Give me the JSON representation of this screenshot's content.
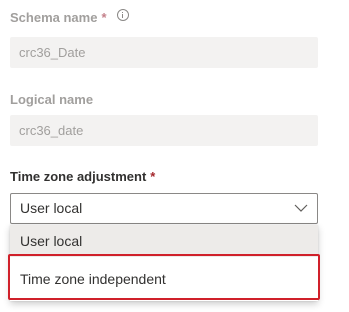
{
  "schema_name": {
    "label": "Schema name",
    "required_mark": "*",
    "value": "crc36_Date"
  },
  "logical_name": {
    "label": "Logical name",
    "value": "crc36_date"
  },
  "time_zone_adjustment": {
    "label": "Time zone adjustment",
    "required_mark": "*",
    "selected_value": "User local",
    "options": [
      "User local",
      "Time zone independent"
    ]
  },
  "colors": {
    "required": "#a4262c",
    "highlight_box": "#d0202a",
    "selected_option_bg": "#edebe9",
    "disabled_field_bg": "#f3f2f1"
  }
}
